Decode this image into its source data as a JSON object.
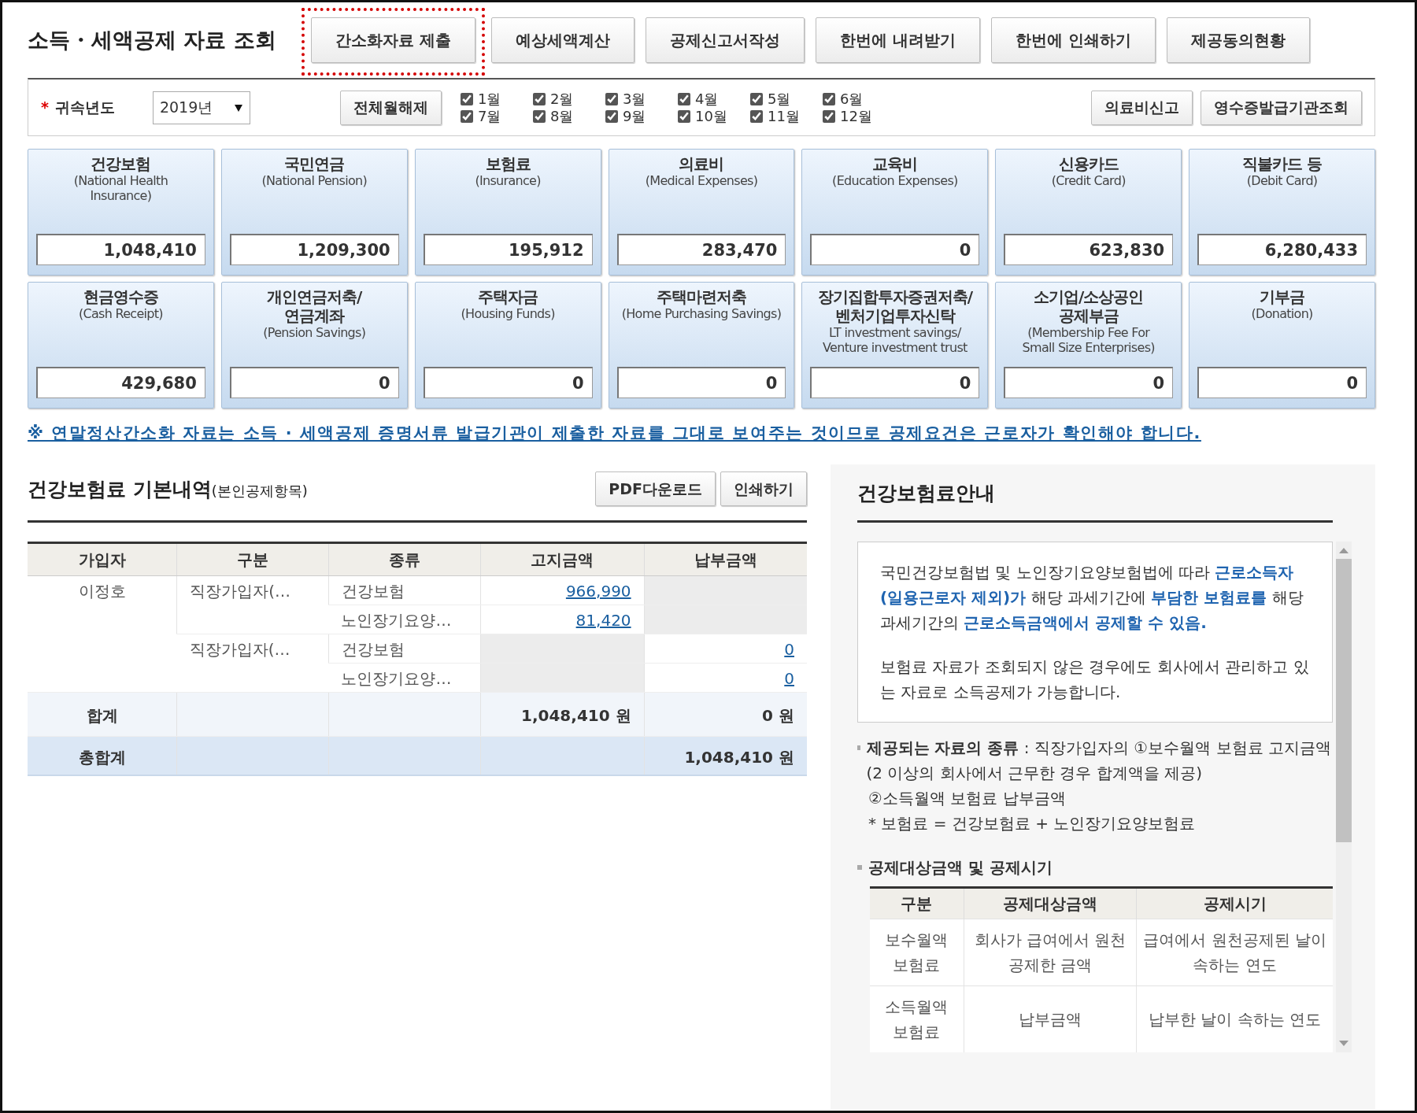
{
  "page_title": "소득・세액공제 자료 조회",
  "top_buttons": [
    {
      "label": "간소화자료 제출",
      "highlighted": true
    },
    {
      "label": "예상세액계산",
      "highlighted": false
    },
    {
      "label": "공제신고서작성",
      "highlighted": false
    },
    {
      "label": "한번에 내려받기",
      "highlighted": false
    },
    {
      "label": "한번에 인쇄하기",
      "highlighted": false
    },
    {
      "label": "제공동의현황",
      "highlighted": false
    }
  ],
  "filter": {
    "required_mark": "*",
    "year_label": "귀속년도",
    "year": "2019년",
    "clear_button": "전체월해제",
    "months": [
      {
        "label": "1월",
        "checked": true
      },
      {
        "label": "2월",
        "checked": true
      },
      {
        "label": "3월",
        "checked": true
      },
      {
        "label": "4월",
        "checked": true
      },
      {
        "label": "5월",
        "checked": true
      },
      {
        "label": "6월",
        "checked": true
      },
      {
        "label": "7월",
        "checked": true
      },
      {
        "label": "8월",
        "checked": true
      },
      {
        "label": "9월",
        "checked": true
      },
      {
        "label": "10월",
        "checked": true
      },
      {
        "label": "11월",
        "checked": true
      },
      {
        "label": "12월",
        "checked": true
      }
    ],
    "right_buttons": [
      "의료비신고",
      "영수증발급기관조회"
    ]
  },
  "categories": [
    {
      "title": "건강보험",
      "subtitle": "(National Health\nInsurance)",
      "amount": "1,048,410"
    },
    {
      "title": "국민연금",
      "subtitle": "(National Pension)",
      "amount": "1,209,300"
    },
    {
      "title": "보험료",
      "subtitle": "(Insurance)",
      "amount": "195,912"
    },
    {
      "title": "의료비",
      "subtitle": "(Medical Expenses)",
      "amount": "283,470"
    },
    {
      "title": "교육비",
      "subtitle": "(Education Expenses)",
      "amount": "0"
    },
    {
      "title": "신용카드",
      "subtitle": "(Credit Card)",
      "amount": "623,830"
    },
    {
      "title": "직불카드 등",
      "subtitle": "(Debit Card)",
      "amount": "6,280,433"
    },
    {
      "title": "현금영수증",
      "subtitle": "(Cash Receipt)",
      "amount": "429,680"
    },
    {
      "title": "개인연금저축/\n연금계좌",
      "subtitle": "(Pension Savings)",
      "amount": "0"
    },
    {
      "title": "주택자금",
      "subtitle": "(Housing Funds)",
      "amount": "0"
    },
    {
      "title": "주택마련저축",
      "subtitle": "(Home Purchasing Savings)",
      "amount": "0"
    },
    {
      "title": "장기집합투자증권저축/\n벤처기업투자신탁",
      "subtitle": "LT investment savings/\nVenture investment trust",
      "amount": "0"
    },
    {
      "title": "소기업/소상공인\n공제부금",
      "subtitle": "(Membership Fee For\nSmall Size Enterprises)",
      "amount": "0"
    },
    {
      "title": "기부금",
      "subtitle": "(Donation)",
      "amount": "0"
    }
  ],
  "notice": "※ 연말정산간소화 자료는 소득 · 세액공제 증명서류 발급기관이 제출한 자료를 그대로 보여주는 것이므로 공제요건은 근로자가 확인해야 합니다.",
  "detail": {
    "title": "건강보험료 기본내역",
    "title_note": "(본인공제항목)",
    "buttons": [
      "PDF다운로드",
      "인쇄하기"
    ],
    "columns": [
      "가입자",
      "구분",
      "종류",
      "고지금액",
      "납부금액"
    ],
    "subscribers": [
      {
        "name": "이정호",
        "groups": [
          {
            "category": "직장가입자(…",
            "items": [
              {
                "type": "건강보험",
                "billed": "966,990"
              },
              {
                "type": "노인장기요양…",
                "billed": "81,420"
              }
            ]
          },
          {
            "category": "직장가입자(…",
            "items": [
              {
                "type": "건강보험",
                "paid": "0"
              },
              {
                "type": "노인장기요양…",
                "paid": "0"
              }
            ]
          }
        ]
      }
    ],
    "subtotal": {
      "label": "합계",
      "billed": "1,048,410 원",
      "paid": "0 원"
    },
    "total": {
      "label": "총합계",
      "paid": "1,048,410 원"
    }
  },
  "guide": {
    "title": "건강보험료안내",
    "intro": [
      "국민건강보험법 및 노인장기요양보험법에 따라 **근로소득자(일용근로자 제외)가** 해당 과세기간에 **부담한 보험료를** 해당 과세기간의 **근로소득금액에서 공제할 수 있음.**",
      "보험료 자료가 조회되지 않은 경우에도 회사에서 관리하고 있는 자료로 소득공제가 가능합니다."
    ],
    "data_types": [
      "**제공되는 자료의 종류** : 직장가입자의 ①보수월액 보험료 고지금액(2 이상의 회사에서 근무한 경우 합계액을 제공)",
      "②소득월액 보험료 납부금액",
      "* 보험료 = 건강보험료 + 노인장기요양보험료"
    ],
    "deduction_heading": "공제대상금액 및 공제시기",
    "deduction_columns": [
      "구분",
      "공제대상금액",
      "공제시기"
    ],
    "deduction_rows": [
      [
        "보수월액 보험료",
        "회사가 급여에서 원천공제한 금액",
        "급여에서 원천공제된 날이 속하는 연도"
      ],
      [
        "소득월액 보험료",
        "납부금액",
        "납부한 날이 속하는 연도"
      ]
    ]
  }
}
